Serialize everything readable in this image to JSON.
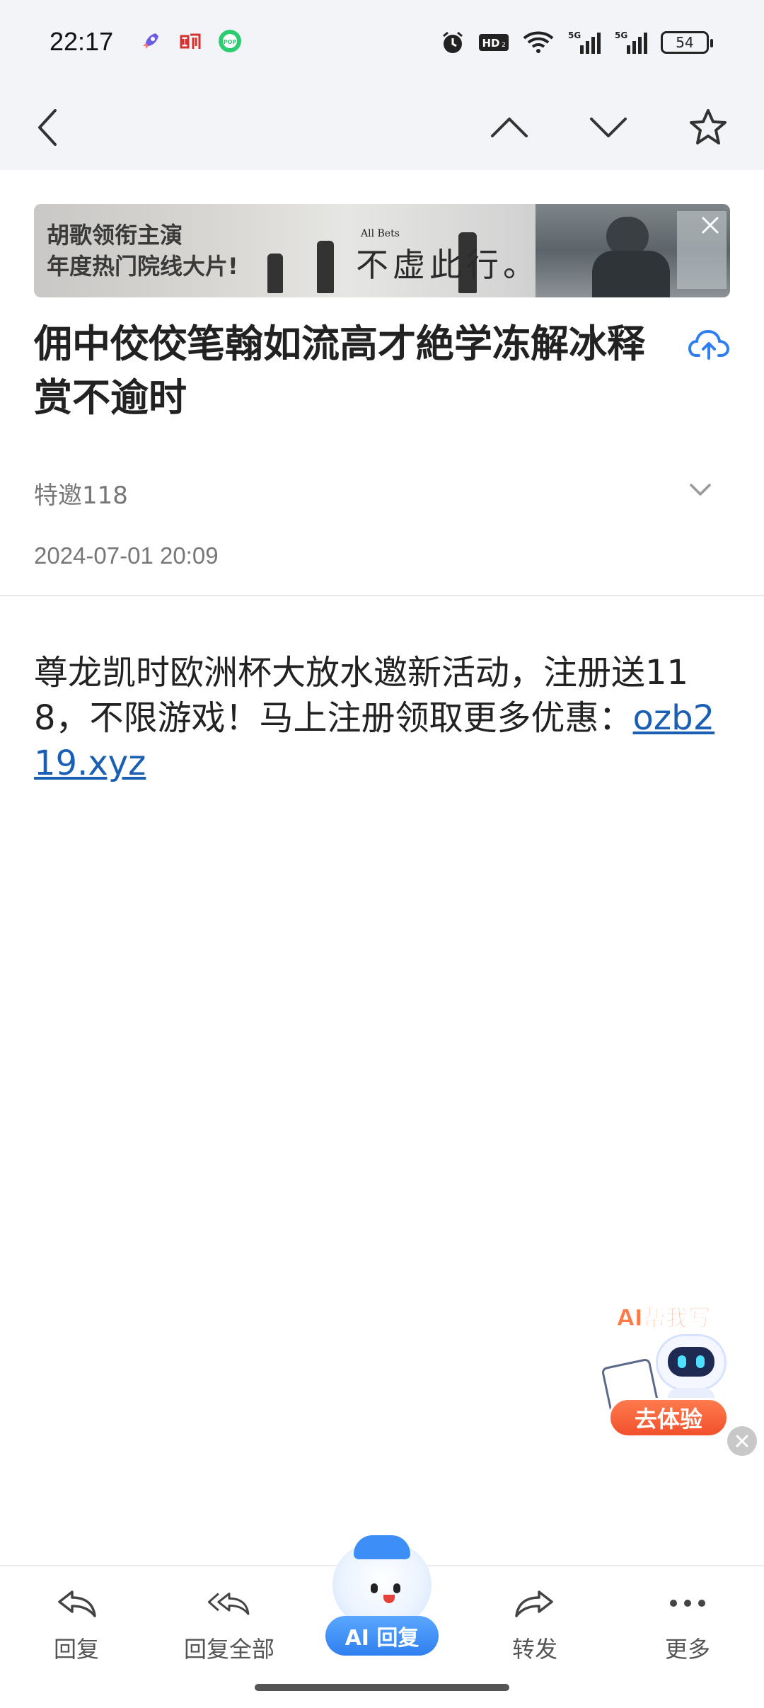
{
  "status_bar": {
    "time": "22:17",
    "notification_icons": [
      "rocket-icon",
      "app-badge-icon",
      "pop-icon"
    ],
    "system_icons": [
      "alarm-icon",
      "hd-icon",
      "wifi-icon",
      "signal-5g-icon",
      "signal-5g-icon"
    ],
    "battery": "54"
  },
  "nav": {
    "back_icon": "chevron-left-icon",
    "prev_icon": "chevron-up-icon",
    "next_icon": "chevron-down-icon",
    "star_icon": "star-icon"
  },
  "banner": {
    "line1": "胡歌领衔主演",
    "line2": "年度热门院线大片!",
    "slogan_small": "All Bets",
    "slogan": "不虚此行。"
  },
  "email": {
    "subject": "佣中佼佼笔翰如流高才絶学冻解冰释赏不逾时",
    "sender": "特邀118",
    "date": "2024-07-01 20:09",
    "body_text": "尊龙凯时欧洲杯大放水邀新活动，注册送118，不限游戏！马上注册领取更多优惠：",
    "body_link": "ozb219.xyz"
  },
  "ai_widget": {
    "title": "AI帮我写",
    "button": "去体验"
  },
  "toolbar": {
    "reply": "回复",
    "reply_all": "回复全部",
    "ai_reply": "AI 回复",
    "forward": "转发",
    "more": "更多"
  },
  "colors": {
    "link": "#1a5fb4",
    "accent": "#2f7ff0",
    "ai_orange": "#f1502b"
  }
}
